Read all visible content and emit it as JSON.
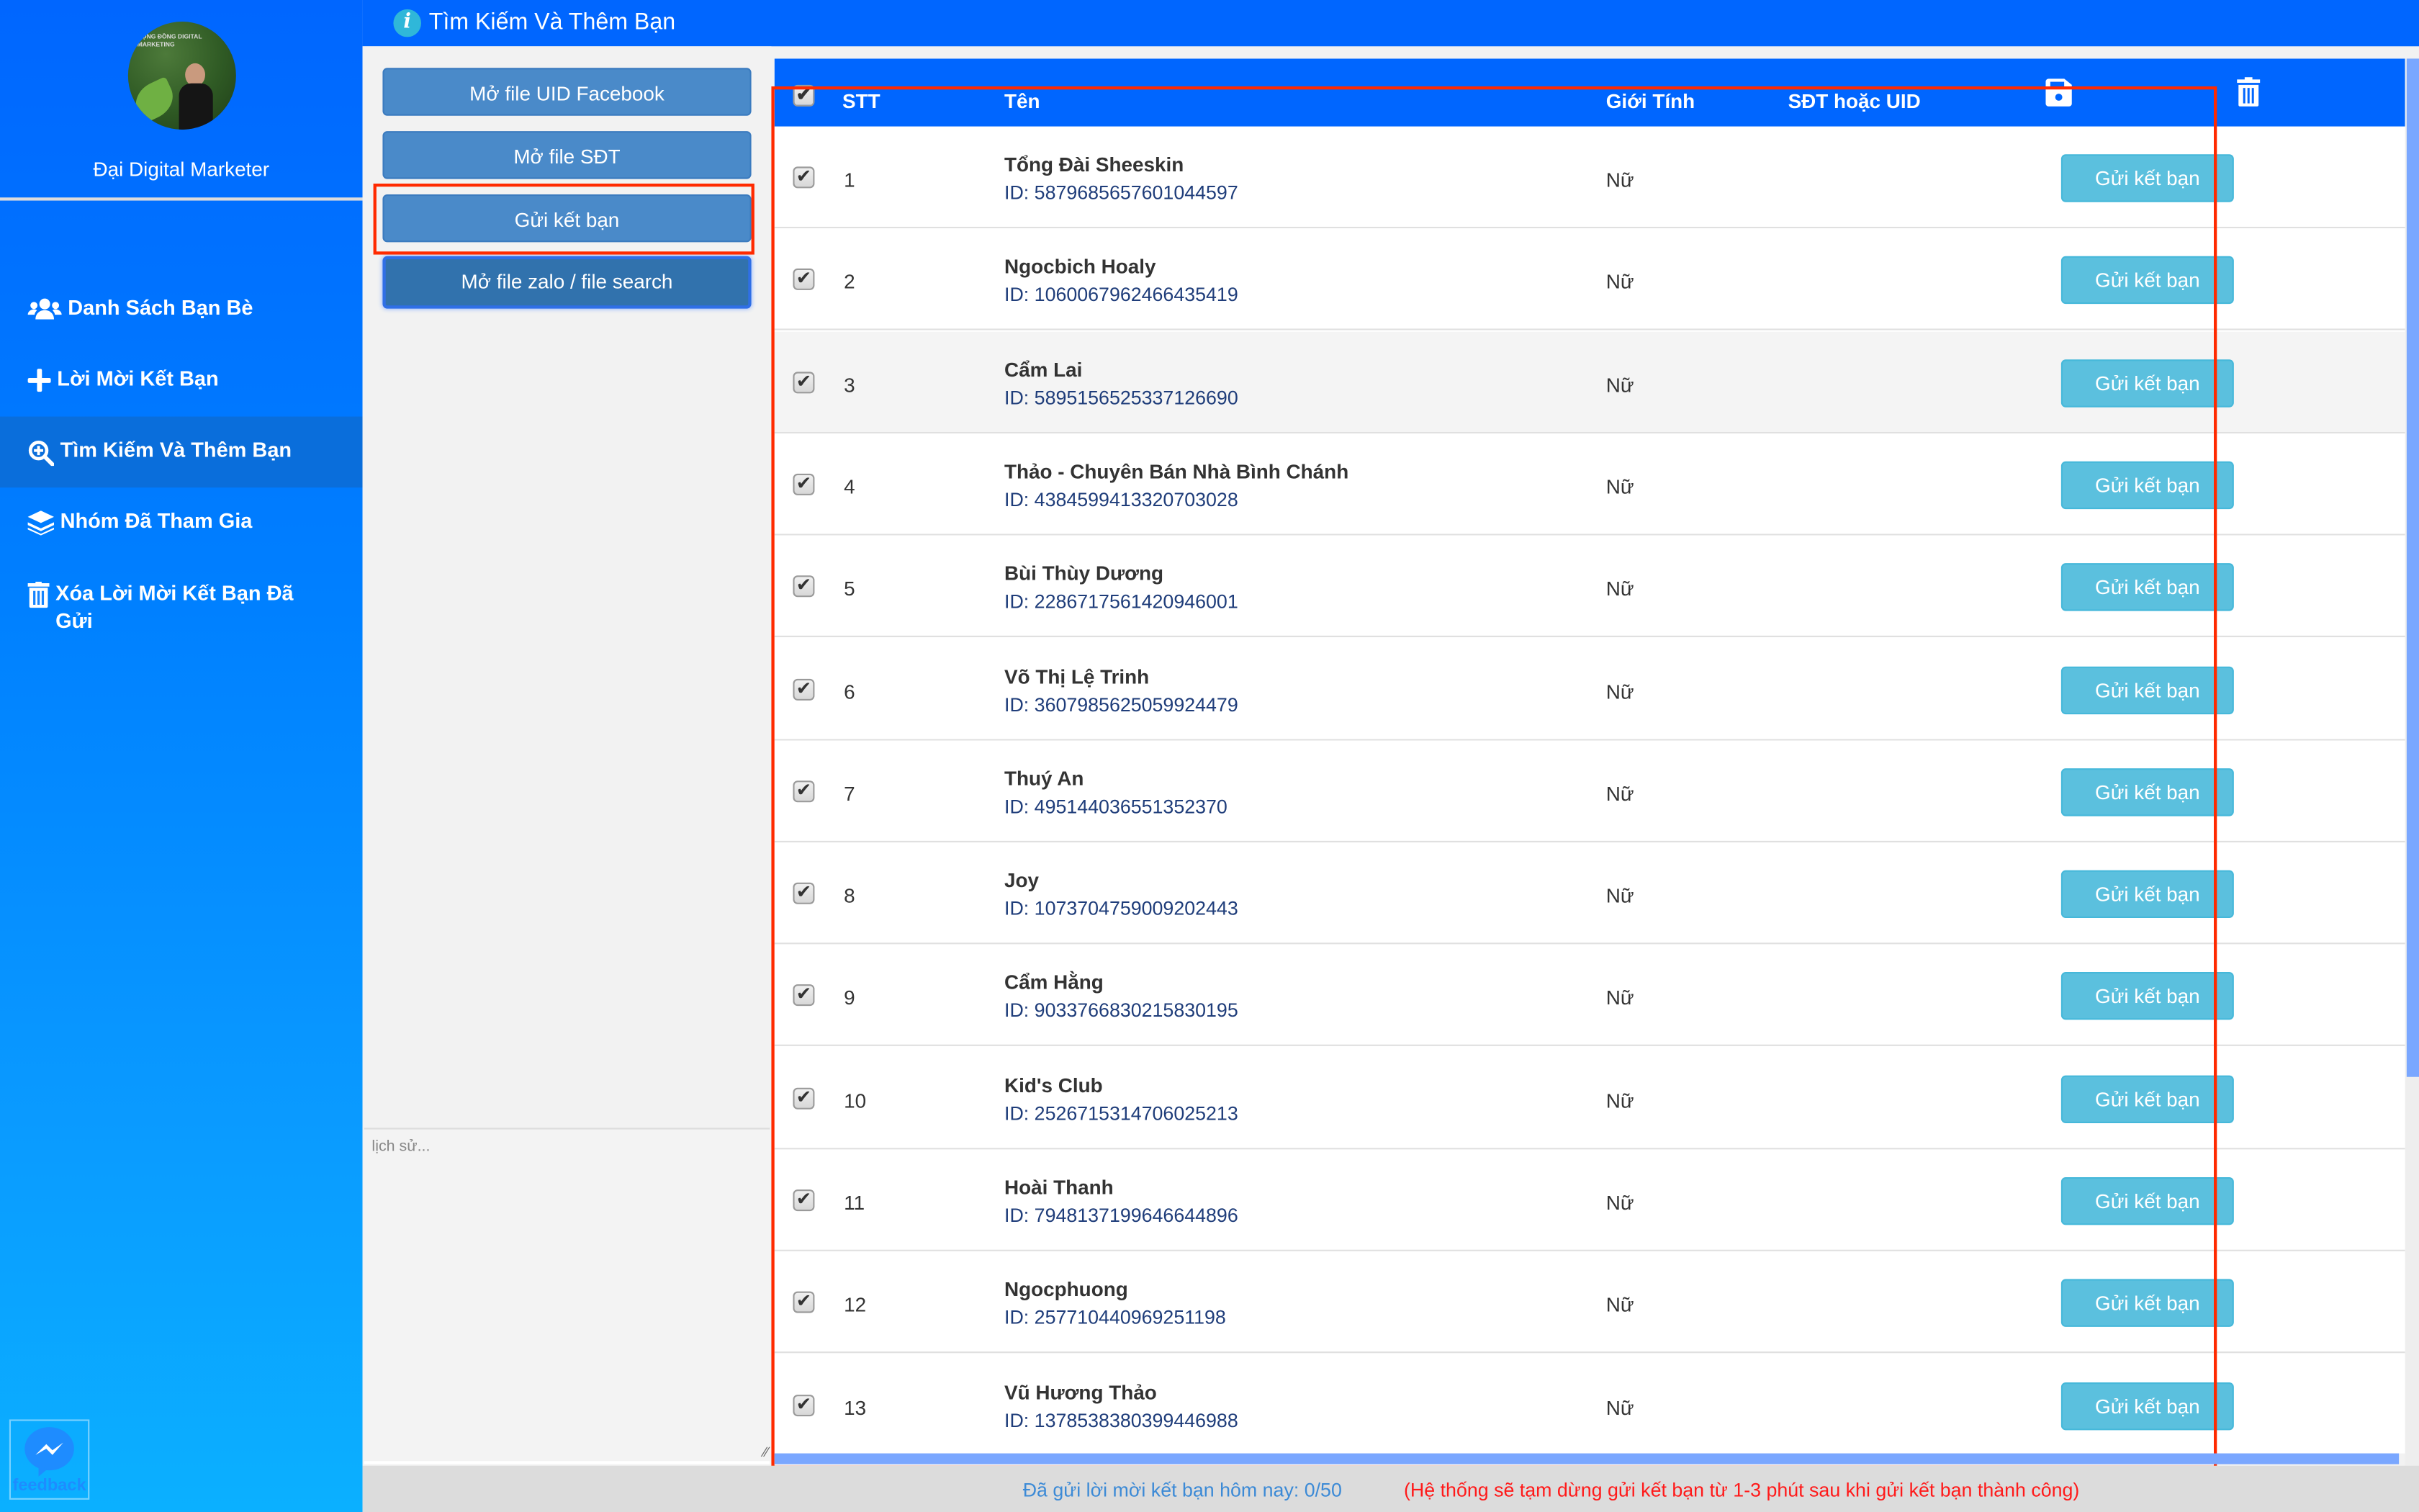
{
  "colors": {
    "primary": "#0066ff",
    "send_button": "#5bc0de",
    "panel_button": "#4a8ac9",
    "warning": "#ff1a1a",
    "highlight": "#ff2a00",
    "scrollbar": "#7aa7ff"
  },
  "sidebar": {
    "user_name": "Đại Digital Marketer",
    "avatar_text": "CỘNG ĐỒNG DIGITAL MARKETING",
    "items": [
      {
        "label": "Danh Sách Bạn Bè",
        "icon": "users-icon",
        "active": false
      },
      {
        "label": "Lời Mời Kết Bạn",
        "icon": "plus-icon",
        "active": false
      },
      {
        "label": "Tìm Kiếm Và Thêm Bạn",
        "icon": "search-plus-icon",
        "active": true
      },
      {
        "label": "Nhóm Đã Tham Gia",
        "icon": "layers-icon",
        "active": false
      },
      {
        "label": "Xóa Lời Mời Kết Bạn Đã Gửi",
        "icon": "trash-icon",
        "active": false
      }
    ],
    "feedback_label": "feedback"
  },
  "header": {
    "title": "Tìm Kiếm Và Thêm Bạn",
    "info_glyph": "i"
  },
  "left_panel": {
    "buttons": [
      {
        "label": "Mở file UID Facebook"
      },
      {
        "label": "Mở file SĐT"
      },
      {
        "label": "Gửi kết bạn"
      },
      {
        "label": "Mở file zalo / file search"
      }
    ],
    "history_placeholder": "lịch sử..."
  },
  "table": {
    "headers": {
      "stt": "STT",
      "name": "Tên",
      "gender": "Giới Tính",
      "phone_uid": "SĐT hoặc UID"
    },
    "row_action_label": "Gửi kết bạn",
    "rows": [
      {
        "stt": "1",
        "name": "Tổng Đài Sheeskin",
        "id": "ID: 5879685657601044597",
        "gender": "Nữ",
        "checked": true
      },
      {
        "stt": "2",
        "name": "Ngocbich Hoaly",
        "id": "ID: 1060067962466435419",
        "gender": "Nữ",
        "checked": true
      },
      {
        "stt": "3",
        "name": "Cẩm Lai",
        "id": "ID: 5895156525337126690",
        "gender": "Nữ",
        "checked": true
      },
      {
        "stt": "4",
        "name": "Thảo - Chuyên Bán Nhà Bình Chánh",
        "id": "ID: 4384599413320703028",
        "gender": "Nữ",
        "checked": true
      },
      {
        "stt": "5",
        "name": "Bùi Thùy Dương",
        "id": "ID: 2286717561420946001",
        "gender": "Nữ",
        "checked": true
      },
      {
        "stt": "6",
        "name": "Võ Thị Lệ Trinh",
        "id": "ID: 3607985625059924479",
        "gender": "Nữ",
        "checked": true
      },
      {
        "stt": "7",
        "name": "Thuý An",
        "id": "ID: 495144036551352370",
        "gender": "Nữ",
        "checked": true
      },
      {
        "stt": "8",
        "name": "Joy",
        "id": "ID: 1073704759009202443",
        "gender": "Nữ",
        "checked": true
      },
      {
        "stt": "9",
        "name": "Cẩm Hằng",
        "id": "ID: 9033766830215830195",
        "gender": "Nữ",
        "checked": true
      },
      {
        "stt": "10",
        "name": "Kid's Club",
        "id": "ID: 2526715314706025213",
        "gender": "Nữ",
        "checked": true
      },
      {
        "stt": "11",
        "name": "Hoài Thanh",
        "id": "ID: 7948137199646644896",
        "gender": "Nữ",
        "checked": true
      },
      {
        "stt": "12",
        "name": "Ngocphuong",
        "id": "ID: 257710440969251198",
        "gender": "Nữ",
        "checked": true
      },
      {
        "stt": "13",
        "name": "Vũ Hương Thảo",
        "id": "ID: 1378538380399446988",
        "gender": "Nữ",
        "checked": true
      }
    ]
  },
  "status": {
    "sent_today": "Đã gửi lời mời kết bạn hôm nay: 0/50",
    "warning": "(Hệ thống sẽ tạm dừng gửi kết bạn từ 1-3 phút sau khi gửi kết bạn thành công)"
  }
}
